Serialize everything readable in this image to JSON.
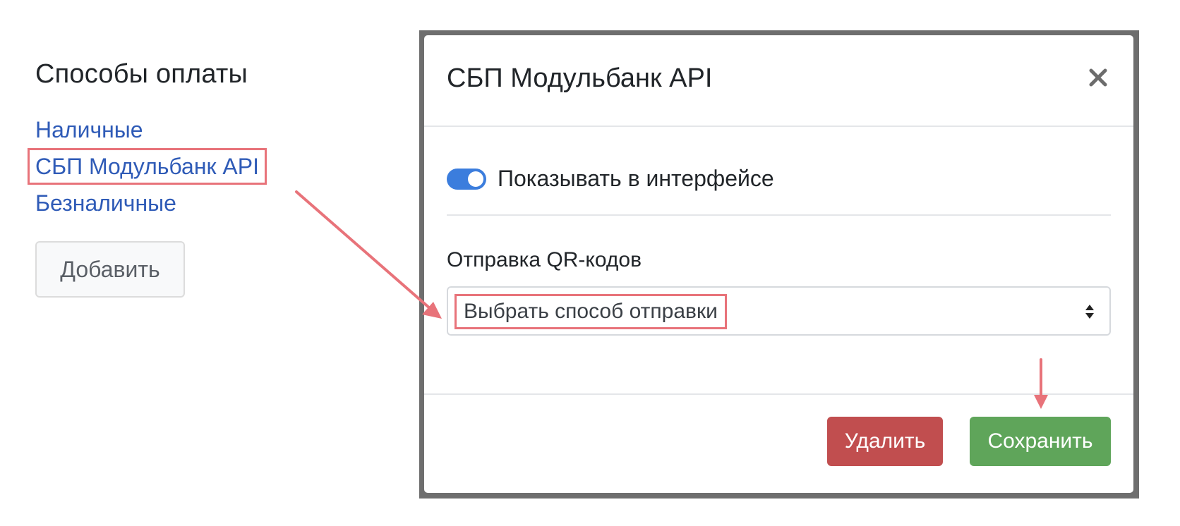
{
  "sidebar": {
    "title": "Способы оплаты",
    "items": [
      {
        "label": "Наличные"
      },
      {
        "label": "СБП Модульбанк API"
      },
      {
        "label": "Безналичные"
      }
    ],
    "add_label": "Добавить"
  },
  "modal": {
    "title": "СБП Модульбанк API",
    "close_symbol": "✕",
    "toggle": {
      "label": "Показывать в интерфейсе",
      "enabled": true
    },
    "field": {
      "label": "Отправка QR-кодов",
      "value": "Выбрать способ отправки"
    },
    "buttons": {
      "delete": "Удалить",
      "save": "Сохранить"
    }
  },
  "colors": {
    "link": "#2f5bb7",
    "toggle": "#3b7ddd",
    "delete": "#c14e4f",
    "save": "#5fa55a",
    "annotation": "#e8737a"
  },
  "icons": [
    "close-icon",
    "select-caret-icon",
    "annotation-arrow-icon"
  ]
}
